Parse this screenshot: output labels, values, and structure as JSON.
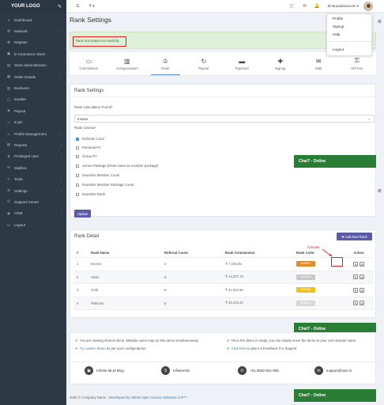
{
  "sidebar": {
    "logo": "YOUR LOGO",
    "items": [
      {
        "label": "Dashboard",
        "icon": "≡",
        "chev": ""
      },
      {
        "label": "Network",
        "icon": "⌘",
        "chev": "›"
      },
      {
        "label": "Register",
        "icon": "✚",
        "chev": ""
      },
      {
        "label": "E-Commerce Store",
        "icon": "▣",
        "chev": ""
      },
      {
        "label": "Store administration",
        "icon": "▤",
        "chev": ""
      },
      {
        "label": "Order Details",
        "icon": "▦",
        "chev": "›"
      },
      {
        "label": "Business",
        "icon": "▥",
        "chev": ""
      },
      {
        "label": "Ewallet",
        "icon": "▢",
        "chev": ""
      },
      {
        "label": "Payout",
        "icon": "◈",
        "chev": ""
      },
      {
        "label": "E-pin",
        "icon": "◇",
        "chev": ""
      },
      {
        "label": "Profile Management",
        "icon": "☺",
        "chev": "›"
      },
      {
        "label": "Reports",
        "icon": "▧",
        "chev": "›"
      },
      {
        "label": "Privileged User",
        "icon": "♛",
        "chev": "›"
      },
      {
        "label": "Mailbox",
        "icon": "✉",
        "chev": ""
      },
      {
        "label": "Tools",
        "icon": "✎",
        "chev": "›"
      },
      {
        "label": "Settings",
        "icon": "⚙",
        "chev": "›"
      },
      {
        "label": "Support Center",
        "icon": "✆",
        "chev": ""
      },
      {
        "label": "CRM",
        "icon": "◉",
        "chev": "›"
      },
      {
        "label": "Logout",
        "icon": "⏻",
        "chev": ""
      }
    ]
  },
  "topbar": {
    "item1": "☰",
    "item2": "₹ ▾",
    "user": "binaryaddonecom ▾"
  },
  "dropdown": {
    "items": [
      "Profile",
      "Signup",
      "Help",
      "Logout"
    ]
  },
  "page": {
    "title": "Rank Settings"
  },
  "alert": {
    "text": "Rank inactivated successfully"
  },
  "tabs": [
    {
      "label": "Commission",
      "icon": "▭"
    },
    {
      "label": "Compensation",
      "icon": "▥"
    },
    {
      "label": "Rank",
      "icon": "♔"
    },
    {
      "label": "Payout",
      "icon": "↻"
    },
    {
      "label": "Payment",
      "icon": "▬"
    },
    {
      "label": "Signup",
      "icon": "✚"
    },
    {
      "label": "Mail",
      "icon": "✉"
    },
    {
      "label": "API Key",
      "icon": "⚿"
    }
  ],
  "rank_settings": {
    "title": "Rank Settings",
    "period_label": "Rank Calculation Period*",
    "period_value": "Instant",
    "criteria_label": "Rank Criteria*",
    "criteria": [
      "Referral Count",
      "Personal PV",
      "Group PV",
      "Joinee Package (Rank same as member package)",
      "Downline Member Count",
      "Downline Member Package Count",
      "Downline Rank"
    ],
    "criteria_checked": [
      true,
      false,
      false,
      false,
      false,
      false,
      false
    ],
    "update_btn": "Update"
  },
  "chat": {
    "label": "Chat? - Online"
  },
  "rank_detail": {
    "title": "Rank Detail",
    "add_btn": "✚ Add New Rank",
    "headers": [
      "#",
      "Rank Name",
      "Referral Count",
      "Rank Commission",
      "Rank Color",
      "Action"
    ],
    "rows": [
      {
        "num": "1",
        "name": "Bronze",
        "count": "2",
        "commission": "₹ 7,103.65",
        "color": "#b6f612",
        "color_hex": "#e08a2a"
      },
      {
        "num": "2",
        "name": "Silver",
        "count": "8",
        "commission": "₹ 14,207.70",
        "color": "#c0c0c0",
        "color_hex": "#c8c8c8"
      },
      {
        "num": "3",
        "name": "Gold",
        "count": "8",
        "commission": "₹ 21,311.56",
        "color": "#ffd700",
        "color_hex": "#f0c21a"
      },
      {
        "num": "4",
        "name": "Platinum",
        "count": "8",
        "commission": "₹ 28,415.41",
        "color": "#e5e4e2",
        "color_hex": "#d8d8d8"
      }
    ],
    "annotation": "Activate"
  },
  "info": {
    "left1_a": "You are viewing shared demo. Multiple users may try this demo simultaneously",
    "left2_link": "Try custom demo",
    "left2_b": " as per your configurations.",
    "right1": "Once the demo is ready, you can simply move the demo to your own domain name.",
    "right2_link": "Click here",
    "right2_b": " to place a Feedback For Support",
    "contacts": [
      {
        "icon": "▣",
        "label": "Infinite MLM Blog"
      },
      {
        "icon": "S",
        "label": "infinitemlm"
      },
      {
        "icon": "✆",
        "label": "+91 9562-941-055"
      },
      {
        "icon": "✉",
        "label": "support@ioss.in"
      }
    ]
  },
  "footer": {
    "prefix": "2020 © Company Name - ",
    "link": "Developed by Infinite Open Source Solutions LLP™"
  }
}
